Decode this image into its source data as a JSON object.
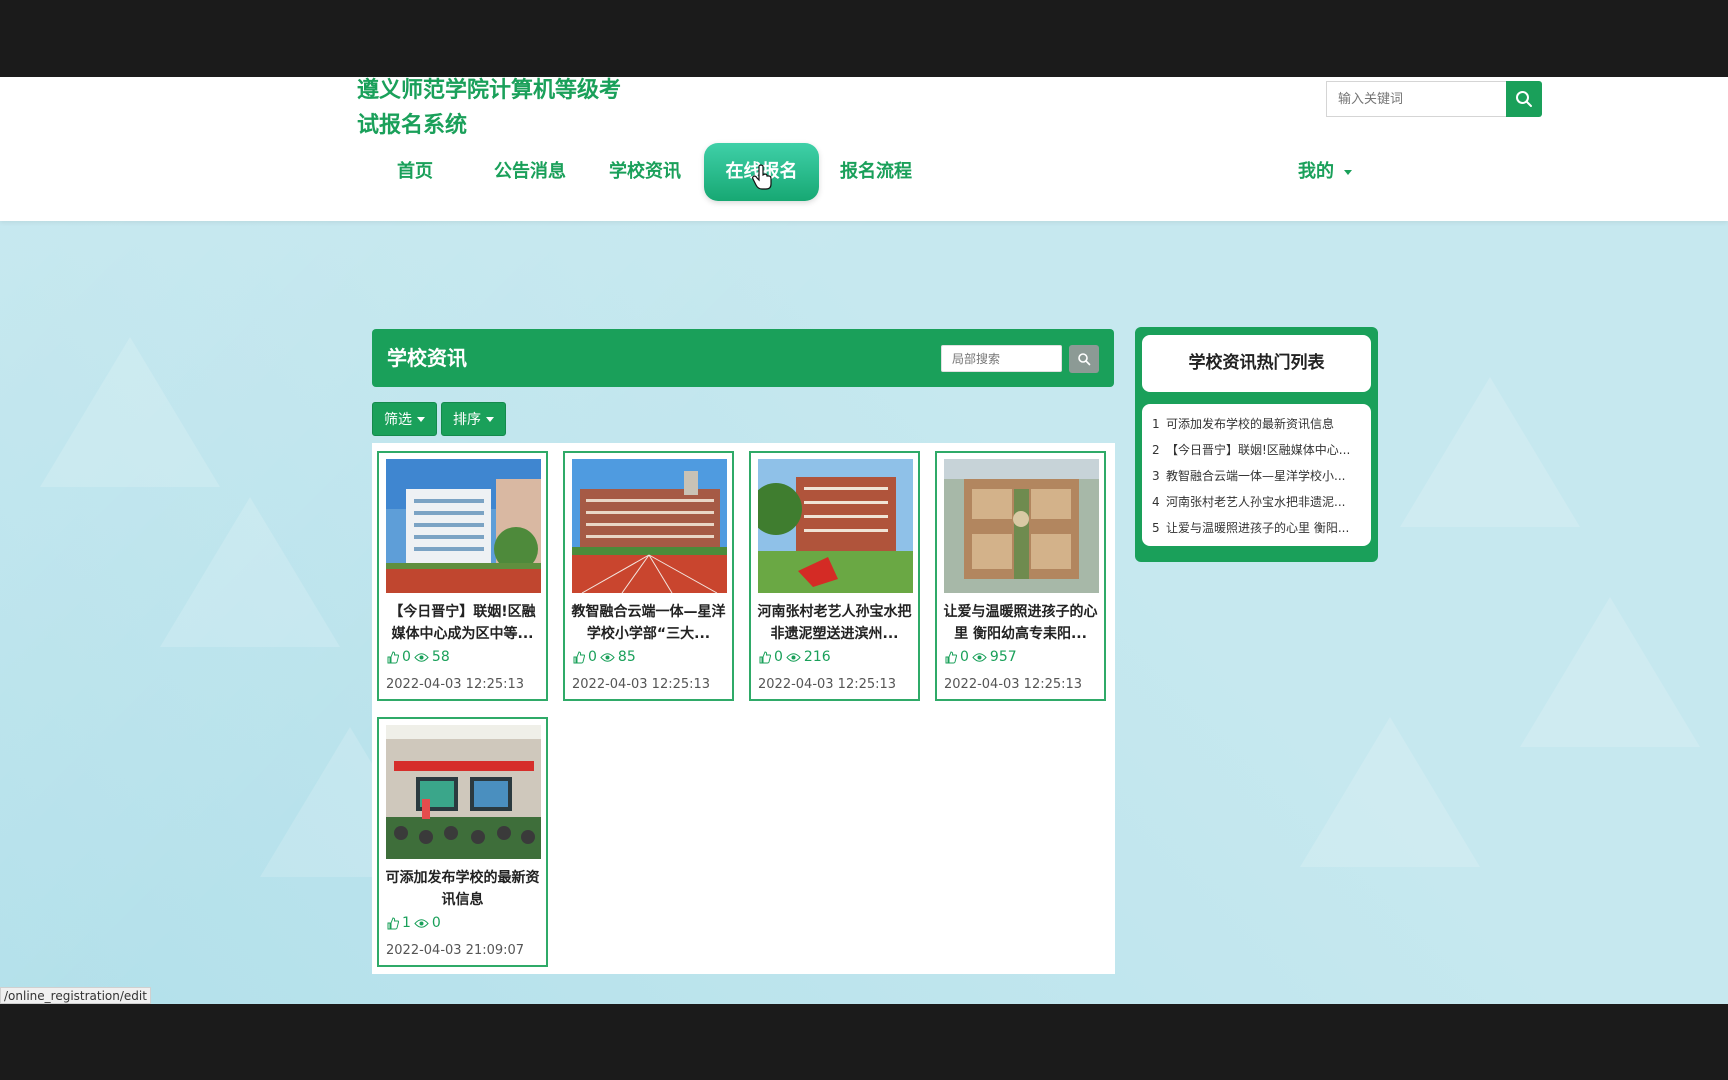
{
  "site": {
    "title": "遵义师范学院计算机等级考试报名系统"
  },
  "nav": {
    "items": [
      {
        "label": "首页"
      },
      {
        "label": "公告消息"
      },
      {
        "label": "学校资讯"
      },
      {
        "label": "在线报名"
      },
      {
        "label": "报名流程"
      }
    ],
    "active": "在线报名",
    "mine": "我的"
  },
  "search": {
    "placeholder": "输入关键词"
  },
  "panel": {
    "title": "学校资讯",
    "local_search_placeholder": "局部搜索",
    "filter_label": "筛选",
    "sort_label": "排序"
  },
  "cards": [
    {
      "title": "【今日晋宁】联姻!区融媒体中心成为区中等...",
      "likes": "0",
      "views": "58",
      "date": "2022-04-03 12:25:13"
    },
    {
      "title": "教智融合云端一体—星洋学校小学部“三大...",
      "likes": "0",
      "views": "85",
      "date": "2022-04-03 12:25:13"
    },
    {
      "title": "河南张村老艺人孙宝水把非遗泥塑送进滨州...",
      "likes": "0",
      "views": "216",
      "date": "2022-04-03 12:25:13"
    },
    {
      "title": "让爱与温暖照进孩子的心里 衡阳幼高专耒阳...",
      "likes": "0",
      "views": "957",
      "date": "2022-04-03 12:25:13"
    },
    {
      "title": "可添加发布学校的最新资讯信息",
      "likes": "1",
      "views": "0",
      "date": "2022-04-03 21:09:07"
    }
  ],
  "hot": {
    "title": "学校资讯热门列表",
    "items": [
      {
        "num": "1",
        "label": "可添加发布学校的最新资讯信息"
      },
      {
        "num": "2",
        "label": "【今日晋宁】联姻!区融媒体中心..."
      },
      {
        "num": "3",
        "label": "教智融合云端一体—星洋学校小..."
      },
      {
        "num": "4",
        "label": "河南张村老艺人孙宝水把非遗泥..."
      },
      {
        "num": "5",
        "label": "让爱与温暖照进孩子的心里 衡阳..."
      }
    ]
  },
  "status_url": "/online_registration/edit",
  "colors": {
    "brand_green": "#1aa05a",
    "active_nav": "#2bbf8a"
  },
  "icons": {
    "search": "search-icon",
    "like": "thumbs-up-icon",
    "view": "eye-icon"
  }
}
